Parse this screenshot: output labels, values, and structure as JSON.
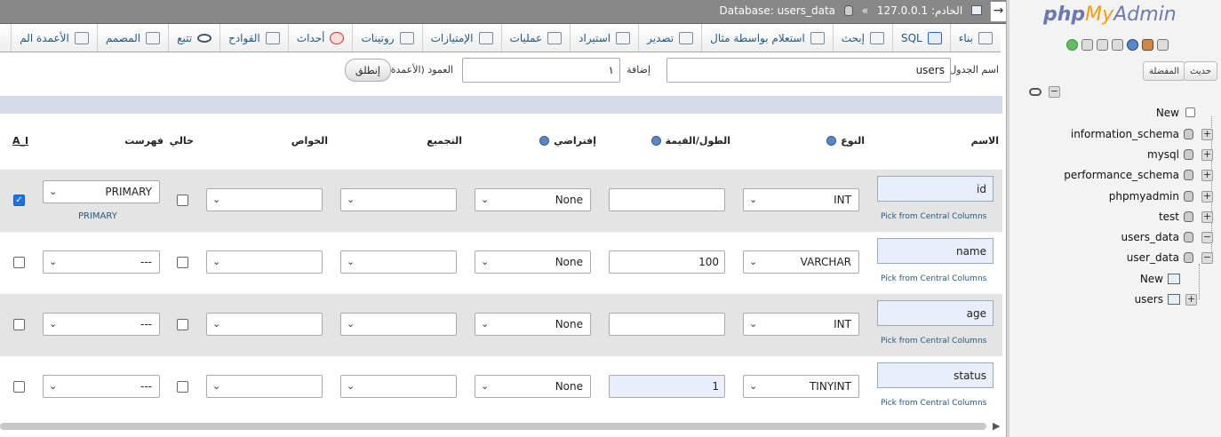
{
  "topbar": {
    "server_label": "الخادم: 127.0.0.1",
    "separator": "»",
    "database_label": "Database: users_data",
    "collapse_icon": "→"
  },
  "tabs": [
    {
      "label": "بناء",
      "icon": "structure-icon"
    },
    {
      "label": "SQL",
      "icon": "sql-icon"
    },
    {
      "label": "إبحث",
      "icon": "search-icon"
    },
    {
      "label": "استعلام بواسطة مثال",
      "icon": "query-icon"
    },
    {
      "label": "تصدير",
      "icon": "export-icon"
    },
    {
      "label": "استيراد",
      "icon": "import-icon"
    },
    {
      "label": "عمليات",
      "icon": "wrench-icon"
    },
    {
      "label": "الإمتيازات",
      "icon": "privileges-icon"
    },
    {
      "label": "روتينات",
      "icon": "routines-icon"
    },
    {
      "label": "أحداث",
      "icon": "events-icon"
    },
    {
      "label": "القوادح",
      "icon": "triggers-icon"
    },
    {
      "label": "تتبع",
      "icon": "eye-icon"
    },
    {
      "label": "المصمم",
      "icon": "designer-icon"
    },
    {
      "label": "الأعمدة الم",
      "icon": "columns-icon"
    }
  ],
  "table_form": {
    "table_name_label": "اسم الجدول:",
    "table_name_value": "users",
    "add_label": "إضافة",
    "add_value": "١",
    "columns_label": "العمود (الأعمدة)",
    "go_label": "إنطلق"
  },
  "headers": {
    "name": "الاسم",
    "type": "النوع",
    "length": "الطول/القيمة",
    "default": "إفتراضي",
    "collation": "التجميع",
    "attributes": "الخواص",
    "null": "خالي",
    "index": "فهرست",
    "ai": "A_I"
  },
  "pick_central": "Pick from Central Columns",
  "fields": [
    {
      "name": "id",
      "type": "INT",
      "length": "",
      "default": "None",
      "collation": "",
      "attributes": "",
      "null": false,
      "index": "PRIMARY",
      "index_link": "PRIMARY",
      "ai": true
    },
    {
      "name": "name",
      "type": "VARCHAR",
      "length": "100",
      "default": "None",
      "collation": "",
      "attributes": "",
      "null": false,
      "index": "---",
      "index_link": "",
      "ai": false
    },
    {
      "name": "age",
      "type": "INT",
      "length": "",
      "default": "None",
      "collation": "",
      "attributes": "",
      "null": false,
      "index": "---",
      "index_link": "",
      "ai": false
    },
    {
      "name": "status",
      "type": "TINYINT",
      "length": "1",
      "default": "None",
      "collation": "",
      "attributes": "",
      "null": false,
      "index": "---",
      "index_link": "",
      "ai": false
    }
  ],
  "sidebar": {
    "logo_php": "php",
    "logo_my": "My",
    "logo_admin": "Admin",
    "recent_button": "حديث",
    "favorites_button": "المفضلة",
    "tree": [
      {
        "label": "New"
      },
      {
        "label": "information_schema"
      },
      {
        "label": "mysql"
      },
      {
        "label": "performance_schema"
      },
      {
        "label": "phpmyadmin"
      },
      {
        "label": "test"
      },
      {
        "label": "users_data"
      },
      {
        "label": "user_data"
      }
    ],
    "subtree": [
      {
        "label": "New"
      },
      {
        "label": "users"
      }
    ]
  },
  "colors": {
    "accent_link": "#235a81",
    "logo_blue": "#6c78af",
    "logo_orange": "#f89c0e",
    "row_alt": "#e4e4e4"
  }
}
